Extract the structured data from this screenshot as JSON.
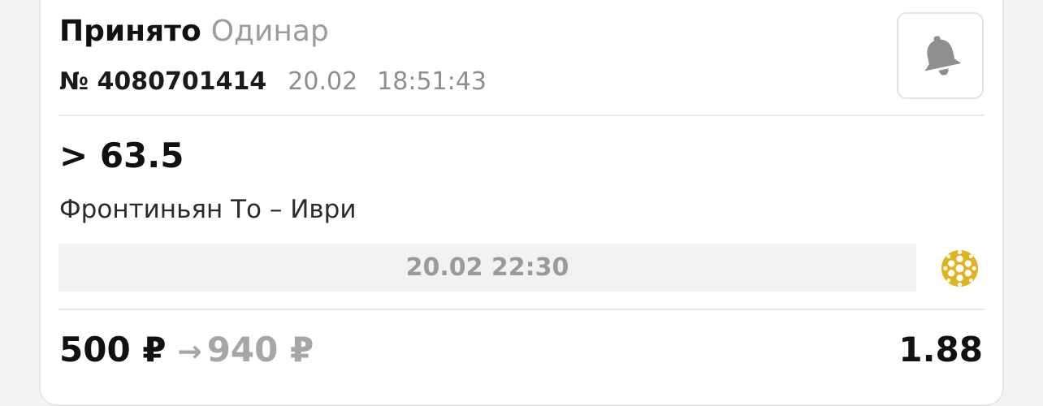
{
  "bet": {
    "status": "Принято",
    "type": "Одинар",
    "number": "№ 4080701414",
    "date": "20.02",
    "time": "18:51:43",
    "selection": "> 63.5",
    "event": "Фронтиньян То – Иври",
    "event_datetime": "20.02 22:30",
    "stake": "500 ₽",
    "arrow": "→",
    "payout": "940 ₽",
    "odds": "1.88"
  },
  "icons": {
    "bell": "bell-icon",
    "sport": "handball-icon"
  },
  "colors": {
    "sport_icon": "#e0b321",
    "bell": "#8f8f8f",
    "muted_text": "#9b9b9b"
  }
}
